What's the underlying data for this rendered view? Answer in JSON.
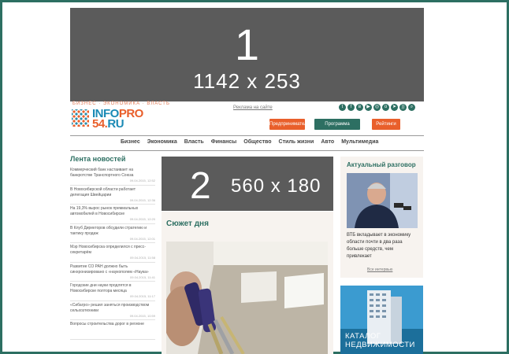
{
  "colors": {
    "brand_green": "#2d6f62",
    "orange": "#e95f2b",
    "blue": "#1b8ab5",
    "placeholder_gray": "#5b5b5b"
  },
  "ad_top": {
    "number": "1",
    "size": "1142 x 253"
  },
  "header": {
    "tags": "БИЗНЕС · ЭКОНОМИКА · ВЛАСТЬ",
    "logo_line1_a": "INFO",
    "logo_line1_b": "PRO",
    "logo_line2_a": "54.",
    "logo_line2_b": "RU",
    "link": "Реклама на сайте",
    "social_icons": [
      "twitter-icon",
      "facebook-icon",
      "vk-icon",
      "youtube-icon",
      "instagram-icon",
      "odnoklassniki-icon",
      "telegram-icon",
      "rss-icon",
      "search-icon"
    ],
    "btn_left": "Предпринимательство",
    "btn_mid": "Программа развития",
    "btn_right": "Рейтинги"
  },
  "nav": {
    "items": [
      "Бизнес",
      "Экономика",
      "Власть",
      "Финансы",
      "Общество",
      "Стиль жизни",
      "Авто",
      "Мультимедиа"
    ]
  },
  "feed": {
    "title": "Лента новостей",
    "items": [
      {
        "text": "Коммерческий банк настаивает на банкротстве Транспортного Союза",
        "date": "09.04.2015, 12:52"
      },
      {
        "text": "В Новосибирской области работает делегация Швейцарии",
        "date": "09.04.2015, 12:36"
      },
      {
        "text": "На 19,3% вырос рынок премиальных автомобилей в Новосибирске",
        "date": "09.04.2015, 12:20"
      },
      {
        "text": "В Клуб Директоров обсудили стратегию и тактику продаж",
        "date": "09.04.2015, 12:01"
      },
      {
        "text": "Мэр Новосибирска определился с пресс-секретарём",
        "date": "09.04.2015, 11:58"
      },
      {
        "text": "Развитие СО РАН должно быть синхронизировано с «наукополем «Наука»",
        "date": "09.04.2015, 11:41"
      },
      {
        "text": "Городские дни науки продлятся в Новосибирске полтора месяца",
        "date": "09.04.2015, 11:17"
      },
      {
        "text": "«Сибагро» решил заняться производством сельхозтехники",
        "date": "09.04.2015, 10:59"
      },
      {
        "text": "Вопросы строительства дорог в регионе",
        "date": ""
      }
    ]
  },
  "ad_mid": {
    "number": "2",
    "size": "560 x 180"
  },
  "story": {
    "title": "Сюжет дня"
  },
  "sidebar": {
    "title": "Актуальный разговор",
    "text": "ВТБ вкладывает в экономику области почти в два раза больше средств, чем привлекает",
    "more": "Все интервью",
    "banner_line1": "КАТАЛОГ",
    "banner_line2": "НЕДВИЖИМОСТИ"
  }
}
